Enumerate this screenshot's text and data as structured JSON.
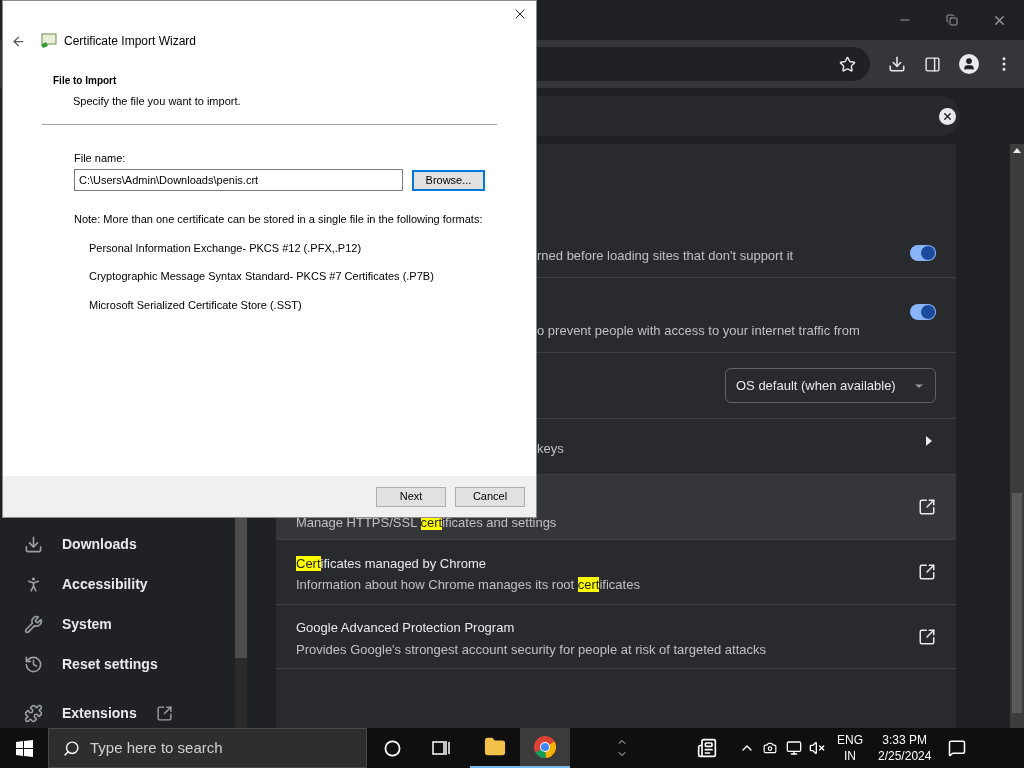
{
  "sidebar": {
    "items": [
      {
        "label": "Downloads",
        "kind": "plain"
      },
      {
        "label": "Accessibility",
        "kind": "plain"
      },
      {
        "label": "System",
        "kind": "plain"
      },
      {
        "label": "Reset settings",
        "kind": "plain"
      },
      {
        "label": "Extensions",
        "kind": "external"
      }
    ]
  },
  "settings_rows": [
    {
      "kind": "toggle",
      "hovered": false,
      "description": [
        {
          "text": "rned before loading sites that don't support it",
          "highlighted": false
        }
      ],
      "on": true
    },
    {
      "kind": "toggle",
      "hovered": false,
      "description": [
        {
          "text": "o prevent people with access to your internet traffic from",
          "highlighted": false
        }
      ],
      "on": true
    },
    {
      "kind": "dropdown",
      "hovered": false,
      "value": "OS default (when available)"
    },
    {
      "kind": "submenu",
      "hovered": false,
      "description": [
        {
          "text": "keys",
          "highlighted": false
        }
      ]
    },
    {
      "kind": "external",
      "hovered": true,
      "description": [
        {
          "text": "Manage HTTPS/SSL ",
          "highlighted": false
        },
        {
          "text": "cert",
          "highlighted": true
        },
        {
          "text": "ificates and settings",
          "highlighted": false
        }
      ]
    },
    {
      "kind": "external",
      "hovered": false,
      "title": [
        {
          "text": "Cert",
          "highlighted": true
        },
        {
          "text": "ificates managed by Chrome",
          "highlighted": false
        }
      ],
      "description": [
        {
          "text": "Information about how Chrome manages its root ",
          "highlighted": false
        },
        {
          "text": "cert",
          "highlighted": true
        },
        {
          "text": "ificates",
          "highlighted": false
        }
      ]
    },
    {
      "kind": "external",
      "hovered": false,
      "title": [
        {
          "text": "Google Advanced Protection Program",
          "highlighted": false
        }
      ],
      "description": [
        {
          "text": "Provides Google's strongest account security for people at risk of targeted attacks",
          "highlighted": false
        }
      ]
    }
  ],
  "dialog": {
    "title": "Certificate Import Wizard",
    "heading": "File to Import",
    "subheading": "Specify the file you want to import.",
    "file_label": "File name:",
    "file_value": "C:\\Users\\Admin\\Downloads\\penis.crt",
    "browse": {
      "label": "Browse...",
      "focused": true
    },
    "note": "Note:  More than one certificate can be stored in a single file in the following formats:",
    "formats": [
      "Personal Information Exchange- PKCS #12 (.PFX,.P12)",
      "Cryptographic Message Syntax Standard- PKCS #7 Certificates (.P7B)",
      "Microsoft Serialized Certificate Store (.SST)"
    ],
    "buttons": [
      {
        "label": "Next",
        "focused": false
      },
      {
        "label": "Cancel",
        "focused": false
      }
    ]
  },
  "taskbar": {
    "search_placeholder": "Type here to search",
    "apps": [
      {
        "kind": "explorer",
        "running": true,
        "selected": false
      },
      {
        "kind": "chrome",
        "running": true,
        "selected": true
      }
    ],
    "language": "ENG",
    "region": "IN",
    "time": "3:33 PM",
    "date": "2/25/2024"
  }
}
